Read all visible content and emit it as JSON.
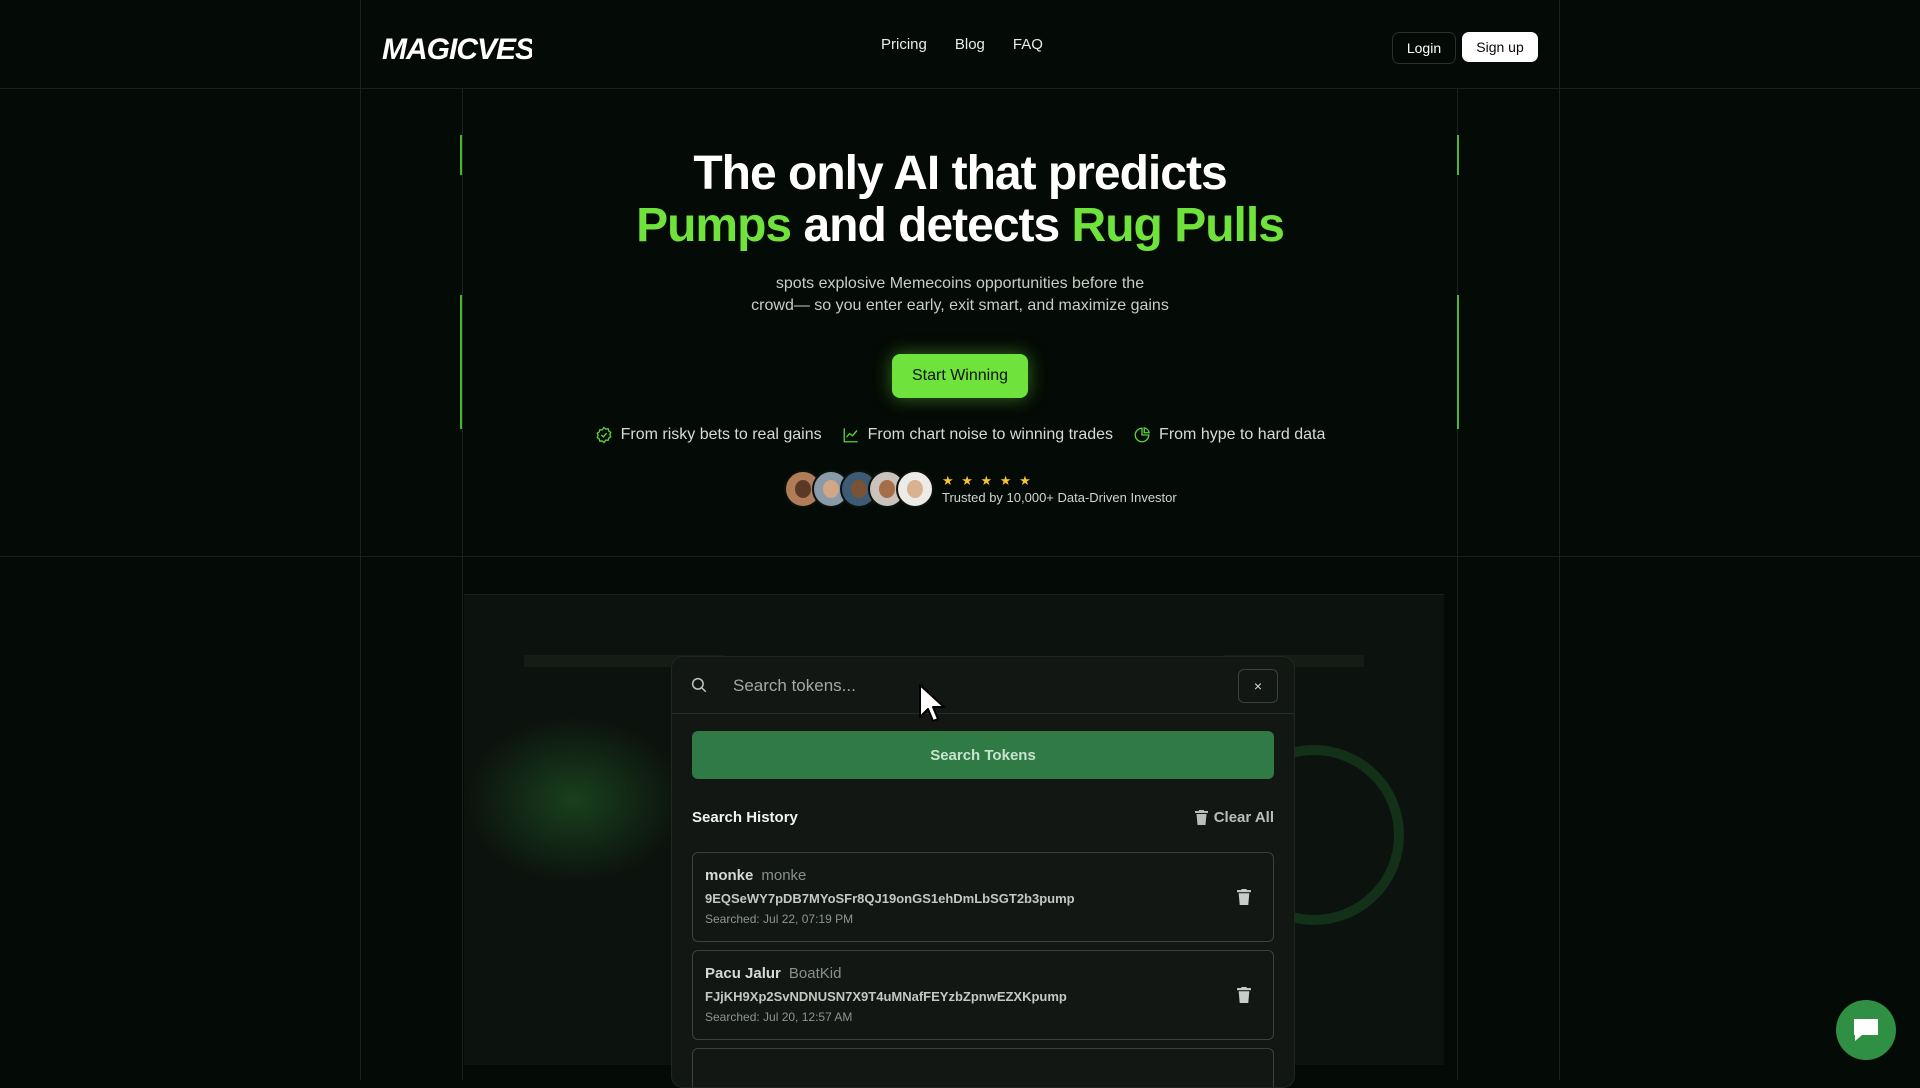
{
  "header": {
    "logo_text": "MAGICVEST",
    "nav": [
      "Pricing",
      "Blog",
      "FAQ"
    ],
    "login_label": "Login",
    "signup_label": "Sign up"
  },
  "hero": {
    "title_line1": "The only AI that predicts",
    "title_green1": "Pumps",
    "title_mid": " and detects ",
    "title_green2": "Rug Pulls",
    "subtitle_line1": "spots explosive Memecoins opportunities before the",
    "subtitle_line2": "crowd— so you enter early, exit smart, and maximize gains",
    "cta_label": "Start Winning",
    "features": [
      {
        "icon": "badge-check-icon",
        "text": "From risky bets to real gains"
      },
      {
        "icon": "line-chart-icon",
        "text": "From chart noise to winning trades"
      },
      {
        "icon": "pie-chart-icon",
        "text": "From hype to hard data"
      }
    ],
    "rating_stars": 5,
    "stars_text": "★ ★ ★ ★ ★",
    "trust_label": "Trusted by 10,000+ Data-Driven Investor"
  },
  "search_panel": {
    "placeholder": "Search tokens...",
    "close_label": "×",
    "search_button": "Search Tokens",
    "history_title": "Search History",
    "clear_all": "Clear All",
    "history": [
      {
        "name": "monke",
        "symbol": "monke",
        "address": "9EQSeWY7pDB7MYoSFr8QJ19onGS1ehDmLbSGT2b3pump",
        "searched": "Searched: Jul 22, 07:19 PM"
      },
      {
        "name": "Pacu Jalur",
        "symbol": "BoatKid",
        "address": "FJjKH9Xp2SvNDNUSN7X9T4uMNafFEYzbZpnwEZXKpump",
        "searched": "Searched: Jul 20, 12:57 AM"
      }
    ]
  },
  "colors": {
    "background": "#040a05",
    "accent_green": "#6fe23c",
    "button_green": "#2f7a45",
    "star": "#f4c531"
  }
}
